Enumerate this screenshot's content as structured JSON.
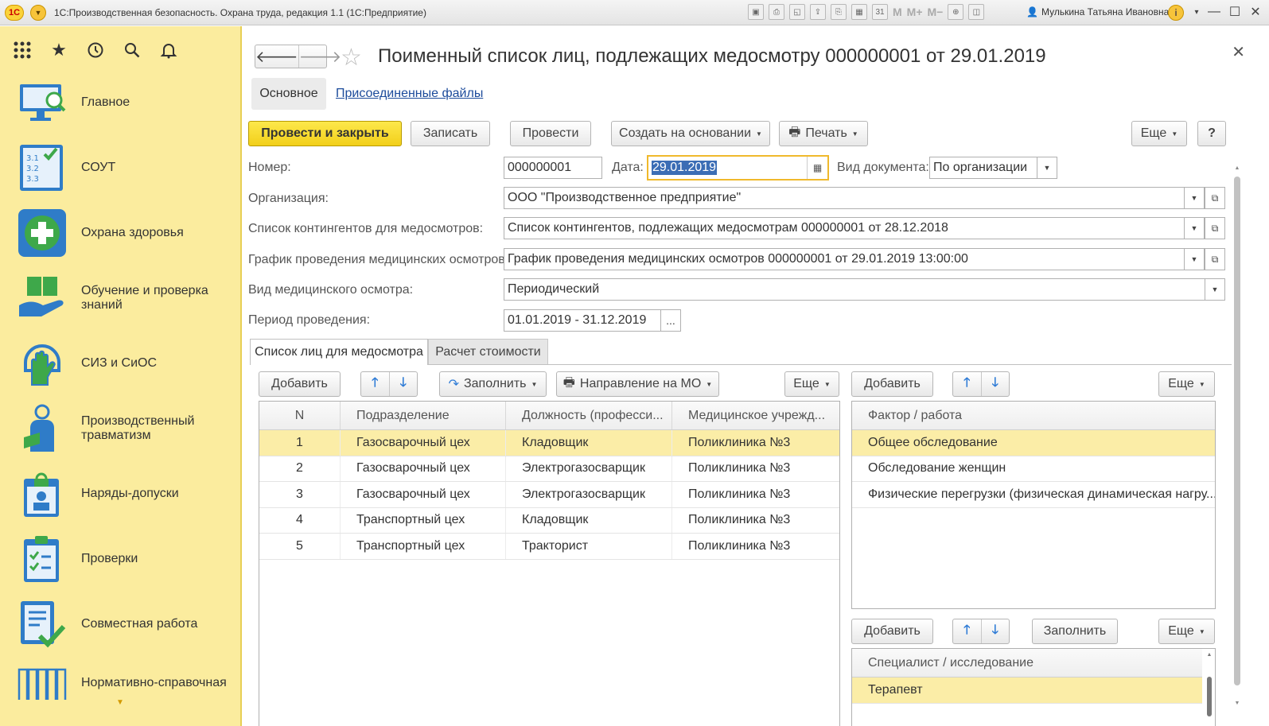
{
  "window": {
    "app_title": "1С:Производственная безопасность. Охрана труда, редакция 1.1  (1С:Предприятие)",
    "user_name": "Мулькина Татьяна Ивановна",
    "logo_text": "1С"
  },
  "sidebar": {
    "items": [
      {
        "label": "Главное",
        "icon": "monitor-search-icon"
      },
      {
        "label": "СОУТ",
        "icon": "checklist-numbers-icon"
      },
      {
        "label": "Охрана здоровья",
        "icon": "medical-cross-icon"
      },
      {
        "label": "Обучение и проверка знаний",
        "icon": "book-hand-icon"
      },
      {
        "label": "СИЗ и СиОС",
        "icon": "glove-icon"
      },
      {
        "label": "Производственный травматизм",
        "icon": "injured-person-icon"
      },
      {
        "label": "Наряды-допуски",
        "icon": "permit-lock-icon"
      },
      {
        "label": "Проверки",
        "icon": "clipboard-check-icon"
      },
      {
        "label": "Совместная работа",
        "icon": "document-check-icon"
      },
      {
        "label": "Нормативно-справочная",
        "icon": "books-icon"
      }
    ]
  },
  "doc": {
    "title": "Поименный список лиц, подлежащих медосмотру 000000001 от 29.01.2019",
    "tab_main": "Основное",
    "tab_files": "Присоединенные файлы"
  },
  "toolbar": {
    "post_close": "Провести и закрыть",
    "save": "Записать",
    "post": "Провести",
    "create_based": "Создать на основании",
    "print": "Печать",
    "more": "Еще",
    "help": "?"
  },
  "form": {
    "number_label": "Номер:",
    "number_value": "000000001",
    "date_label": "Дата:",
    "date_value": "29.01.2019",
    "doc_type_label": "Вид документа:",
    "doc_type_value": "По организации",
    "org_label": "Организация:",
    "org_value": "ООО \"Производственное предприятие\"",
    "contingent_label": "Список контингентов для медосмотров:",
    "contingent_value": "Список контингентов, подлежащих медосмотрам 000000001 от 28.12.2018",
    "schedule_label": "График проведения медицинских осмотров:",
    "schedule_value": "График проведения медицинских осмотров 000000001 от 29.01.2019 13:00:00",
    "exam_type_label": "Вид медицинского осмотра:",
    "exam_type_value": "Периодический",
    "period_label": "Период проведения:",
    "period_value": "01.01.2019 - 31.12.2019",
    "period_btn": "..."
  },
  "inner_tabs": {
    "list": "Список лиц для медосмотра",
    "cost": "Расчет стоимости"
  },
  "left_panel": {
    "add": "Добавить",
    "fill": "Заполнить",
    "direction": "Направление на МО",
    "more": "Еще",
    "columns": [
      "N",
      "Подразделение",
      "Должность (професси...",
      "Медицинское учрежд..."
    ],
    "rows": [
      {
        "n": "1",
        "dep": "Газосварочный цех",
        "pos": "Кладовщик",
        "med": "Поликлиника №3"
      },
      {
        "n": "2",
        "dep": "Газосварочный цех",
        "pos": "Электрогазосварщик",
        "med": "Поликлиника №3"
      },
      {
        "n": "3",
        "dep": "Газосварочный цех",
        "pos": "Электрогазосварщик",
        "med": "Поликлиника №3"
      },
      {
        "n": "4",
        "dep": "Транспортный цех",
        "pos": "Кладовщик",
        "med": "Поликлиника №3"
      },
      {
        "n": "5",
        "dep": "Транспортный цех",
        "pos": "Тракторист",
        "med": "Поликлиника №3"
      }
    ]
  },
  "factor_panel": {
    "add": "Добавить",
    "more": "Еще",
    "column": "Фактор / работа",
    "rows": [
      "Общее обследование",
      "Обследование женщин",
      "Физические перегрузки (физическая динамическая нагру..."
    ]
  },
  "specialist_panel": {
    "add": "Добавить",
    "fill": "Заполнить",
    "more": "Еще",
    "column": "Специалист / исследование",
    "rows": [
      "Терапевт"
    ]
  }
}
